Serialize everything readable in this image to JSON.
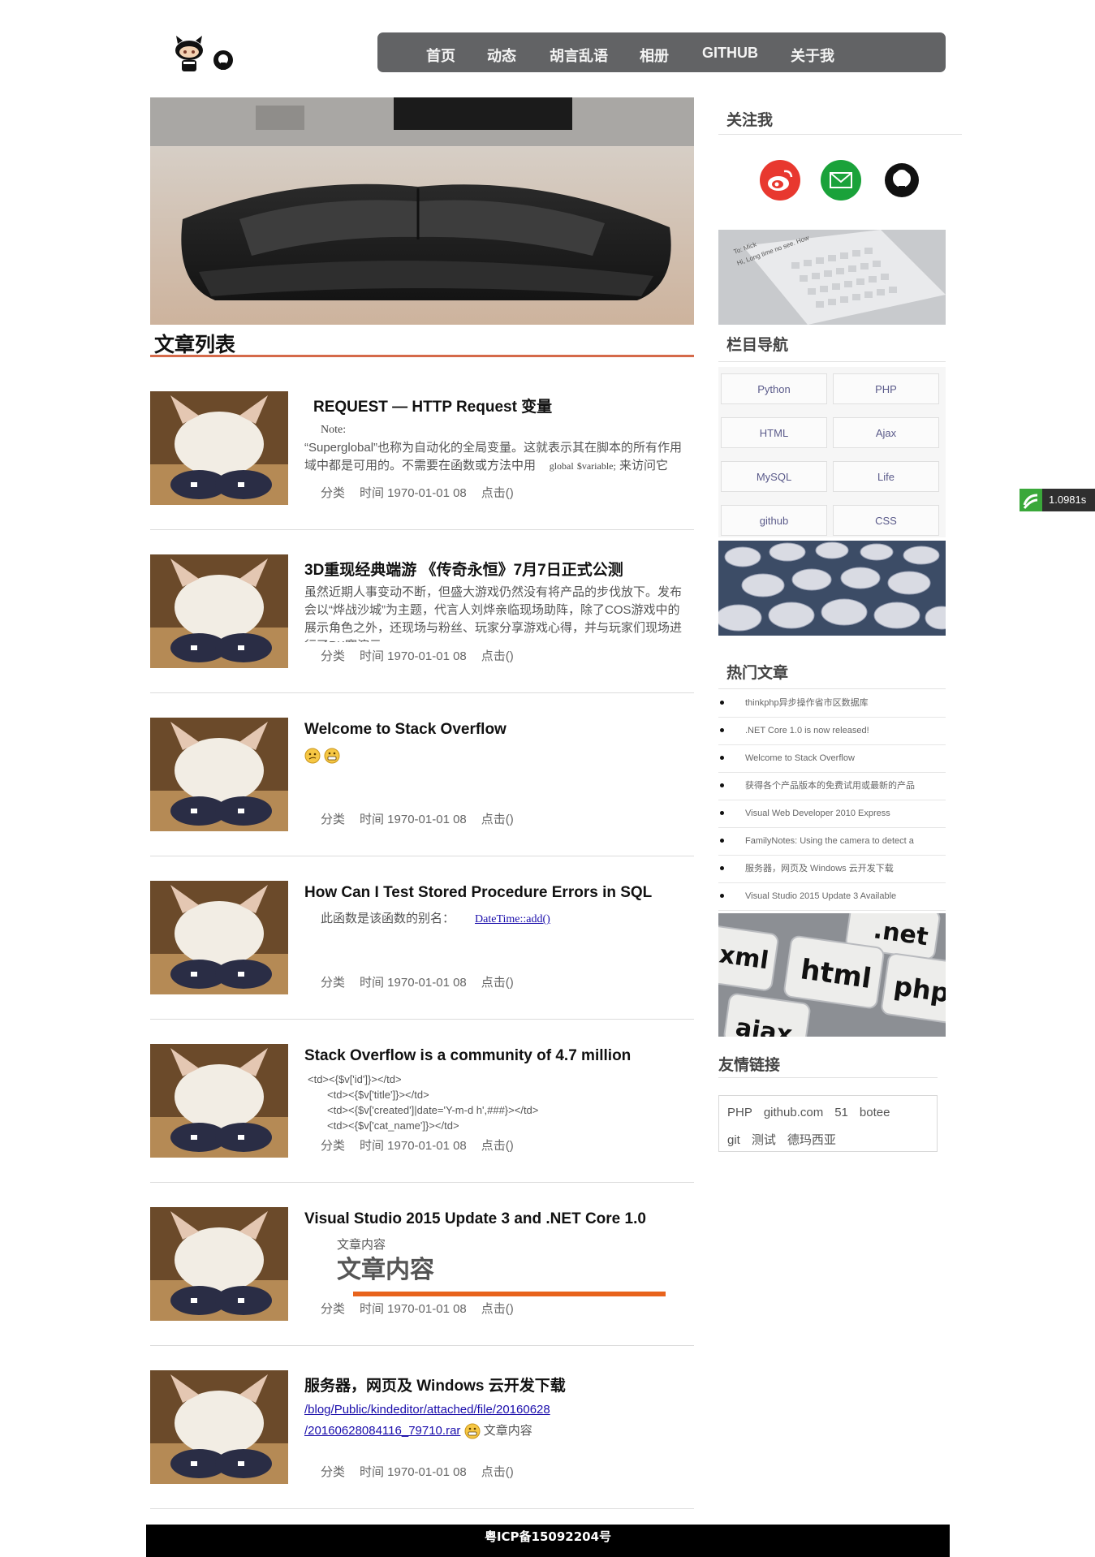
{
  "nav": {
    "items": [
      "首页",
      "动态",
      "胡言乱语",
      "相册",
      "GITHUB",
      "关于我"
    ]
  },
  "list_title": "文章列表",
  "posts": [
    {
      "title": "REQUEST — HTTP Request 变量",
      "note": "Note:",
      "body1": "“Superglobal”也称为自动化的全局变量。这就表示其在脚本的所有作用域中都是可用的。不需要在函数或方法中用",
      "body_serif1": "global",
      "body_serif2": "$variable;",
      "body2": "来访问它",
      "category": "分类",
      "time": "时间 1970-01-01 08",
      "clicks": "点击()"
    },
    {
      "title": "3D重现经典端游 《传奇永恒》7月7日正式公测",
      "body1": "虽然近期人事变动不断，但盛大游戏仍然没有将产品的步伐放下。发布会以“烨战沙城”为主题，代言人刘烨亲临现场助阵，除了COS游戏中的展示角色之外，还现场与粉丝、玩家分享游戏心得，并与玩家们现场进行了PK赛演示。",
      "category": "分类",
      "time": "时间 1970-01-01 08",
      "clicks": "点击()"
    },
    {
      "title": "Welcome to Stack Overflow",
      "category": "分类",
      "time": "时间 1970-01-01 08",
      "clicks": "点击()"
    },
    {
      "title": "How Can I Test Stored Procedure Errors in SQL",
      "body1": "此函数是该函数的别名：",
      "link": "DateTime::add()",
      "category": "分类",
      "time": "时间 1970-01-01 08",
      "clicks": "点击()"
    },
    {
      "title": "Stack Overflow is a community of 4.7 million",
      "code": [
        "<td><{$v['id']}></td>",
        "<td><{$v['title']}></td>",
        "<td><{$v['created']|date='Y-m-d h',###}></td>",
        "<td><{$v['cat_name']}></td>"
      ],
      "category": "分类",
      "time": "时间 1970-01-01 08",
      "clicks": "点击()"
    },
    {
      "title": "Visual Studio 2015 Update 3 and .NET Core 1.0",
      "small": "文章内容",
      "big": "文章内容",
      "category": "分类",
      "time": "时间 1970-01-01 08",
      "clicks": "点击()"
    },
    {
      "title": "服务器，网页及 Windows 云开发下载",
      "link1": "/blog/Public/kindeditor/attached/file/20160628",
      "link2": "/20160628084116_79710.rar",
      "after": "文章内容",
      "category": "分类",
      "time": "时间 1970-01-01 08",
      "clicks": "点击()"
    }
  ],
  "sidebar": {
    "follow_title": "关注我",
    "categories_title": "栏目导航",
    "categories": [
      "Python",
      "PHP",
      "HTML",
      "Ajax",
      "MySQL",
      "Life",
      "github",
      "CSS"
    ],
    "hot_title": "热门文章",
    "hot": [
      "thinkphp异步操作省市区数据库",
      ".NET Core 1.0 is now released!",
      "Welcome to Stack Overflow",
      "获得各个产品版本的免费试用或最新的产品",
      "Visual Web Developer 2010 Express",
      "FamilyNotes: Using the camera to detect a",
      "服务器，网页及 Windows 云开发下载",
      "Visual Studio 2015 Update 3 Available"
    ],
    "friends_title": "友情链接",
    "friends": [
      "PHP",
      "github.com",
      "51",
      "botee",
      "git",
      "测试",
      "德玛西亚"
    ],
    "keyboard_text1": "To: Mick",
    "keyboard_text2": "Hi, Long time no see. How",
    "keys": [
      ".net",
      "xml",
      "html",
      "php",
      "ajax"
    ]
  },
  "perf": "1.0981s",
  "footer": "粤ICP备15092204号",
  "colors": {
    "nav_bg": "#626365",
    "title_bar": "#d56a4a",
    "weibo": "#e8382f",
    "mail": "#1aa23a",
    "footer_bg": "#000000"
  }
}
